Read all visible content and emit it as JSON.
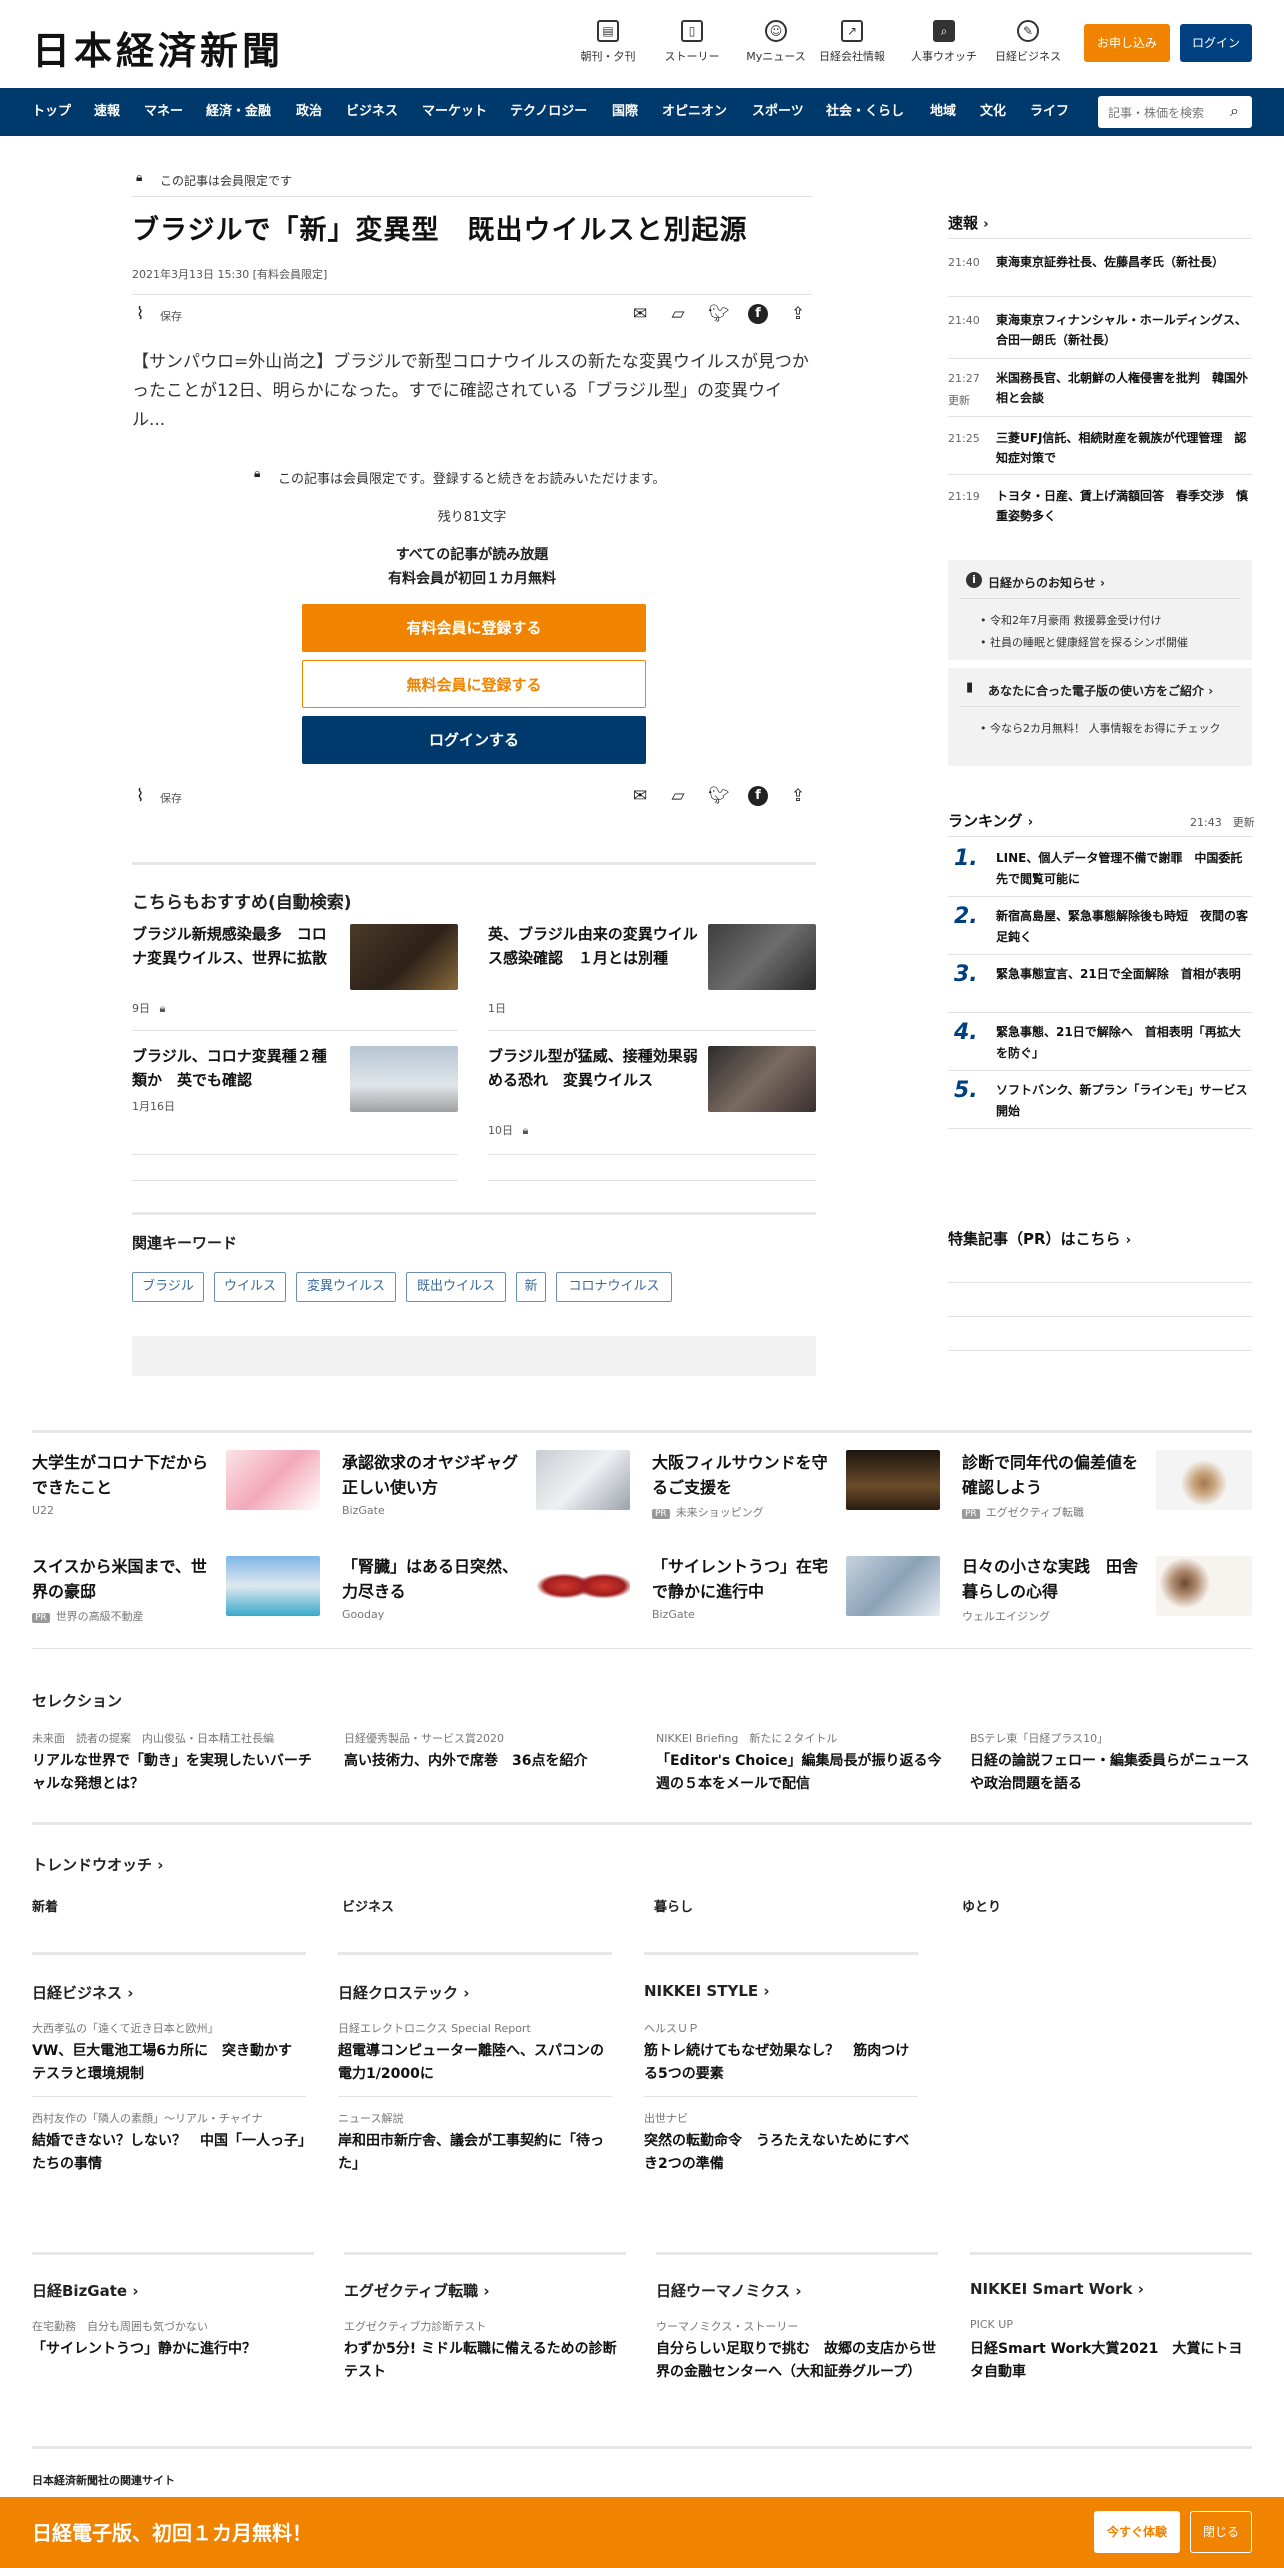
{
  "header": {
    "logo": "日本経済新聞",
    "icons": [
      {
        "label": "朝刊・夕刊",
        "icon": "newspaper-icon"
      },
      {
        "label": "ストーリー",
        "icon": "story-icon"
      },
      {
        "label": "Myニュース",
        "icon": "person-icon"
      },
      {
        "label": "日経会社情報",
        "icon": "chart-icon"
      },
      {
        "label": "人事ウオッチ",
        "icon": "search-icon"
      },
      {
        "label": "日経ビジネス",
        "icon": "compass-icon"
      }
    ],
    "subscribe": "お申し込み",
    "login": "ログイン"
  },
  "nav": {
    "items": [
      "トップ",
      "速報",
      "マネー",
      "経済・金融",
      "政治",
      "ビジネス",
      "マーケット",
      "テクノロジー",
      "国際",
      "オピニオン",
      "スポーツ",
      "社会・くらし",
      "地域",
      "文化",
      "ライフ"
    ],
    "search_placeholder": "記事・株価を検索"
  },
  "article": {
    "member_only": "この記事は会員限定です",
    "title": "ブラジルで「新」変異型　既出ウイルスと別起源",
    "date": "2021年3月13日 15:30 [有料会員限定]",
    "save": "保存",
    "lead": "【サンパウロ=外山尚之】ブラジルで新型コロナウイルスの新たな変異ウイルスが見つかったことが12日、明らかになった。すでに確認されている「ブラジル型」の変異ウイル...",
    "member_notice": "この記事は会員限定です。登録すると続きをお読みいただけます。",
    "remaining": "残り81文字",
    "promo1": "すべての記事が読み放題",
    "promo2": "有料会員が初回１カ月無料",
    "paid_btn": "有料会員に登録する",
    "free_btn": "無料会員に登録する",
    "login_btn": "ログインする",
    "save2": "保存"
  },
  "recommend": {
    "heading": "こちらもおすすめ(自動検索)",
    "items": [
      {
        "title": "ブラジル新規感染最多　コロナ変異ウイルス、世界に拡散",
        "meta": "9日"
      },
      {
        "title": "英、ブラジル由来の変異ウイルス感染確認　１月とは別種",
        "meta": "1日"
      },
      {
        "title": "ブラジル、コロナ変異種２種類か　英でも確認",
        "meta": "1月16日"
      },
      {
        "title": "ブラジル型が猛威、接種効果弱める恐れ　変異ウイルス",
        "meta": "10日"
      }
    ]
  },
  "keywords": {
    "heading": "関連キーワード",
    "items": [
      "ブラジル",
      "ウイルス",
      "変異ウイルス",
      "既出ウイルス",
      "新",
      "コロナウイルス"
    ]
  },
  "sidebar": {
    "breaking_heading": "速報",
    "breaking": [
      {
        "time": "21:40",
        "text": "東海東京証券社長、佐藤昌孝氏（新社長）"
      },
      {
        "time": "21:40",
        "text": "東海東京フィナンシャル・ホールディングス、合田一朗氏（新社長）"
      },
      {
        "time": "21:27",
        "badge": "更新",
        "text": "米国務長官、北朝鮮の人権侵害を批判　韓国外相と会談"
      },
      {
        "time": "21:25",
        "text": "三菱UFJ信託、相続財産を親族が代理管理　認知症対策で"
      },
      {
        "time": "21:19",
        "text": "トヨタ・日産、賃上げ満額回答　春季交渉　慎重姿勢多く"
      }
    ],
    "notice_heading": "日経からのお知らせ",
    "notices": [
      "令和2年7月豪雨 救援募金受け付け",
      "社員の睡眠と健康経営を探るシンポ開催"
    ],
    "guide_heading": "あなたに合った電子版の使い方をご紹介",
    "guide": "今なら2カ月無料！ 人事情報をお得にチェック",
    "ranking_heading": "ランキング",
    "ranking_time": "21:43",
    "ranking_update": "更新",
    "ranking": [
      {
        "num": "1.",
        "text": "LINE、個人データ管理不備で謝罪　中国委託先で閲覧可能に"
      },
      {
        "num": "2.",
        "text": "新宿高島屋、緊急事態解除後も時短　夜間の客足鈍く"
      },
      {
        "num": "3.",
        "text": "緊急事態宣言、21日で全面解除　首相が表明"
      },
      {
        "num": "4.",
        "text": "緊急事態、21日で解除へ　首相表明「再拡大を防ぐ」"
      },
      {
        "num": "5.",
        "text": "ソフトバンク、新プラン「ラインモ」サービス開始"
      }
    ],
    "feature_heading": "特集記事（PR）はこちら"
  },
  "promos": {
    "row1": [
      {
        "title": "大学生がコロナ下だからできたこと",
        "source": "U22",
        "pr": false
      },
      {
        "title": "承認欲求のオヤジギャグ正しい使い方",
        "source": "BizGate",
        "pr": false
      },
      {
        "title": "大阪フィルサウンドを守るご支援を",
        "source": "未来ショッピング",
        "pr": true
      },
      {
        "title": "診断で同年代の偏差値を確認しよう",
        "source": "エグゼクティブ転職",
        "pr": true
      }
    ],
    "row2": [
      {
        "title": "スイスから米国まで、世界の豪邸",
        "source": "世界の高級不動産",
        "pr": true
      },
      {
        "title": "「腎臓」はある日突然、力尽きる",
        "source": "Gooday",
        "pr": false
      },
      {
        "title": "「サイレントうつ」在宅で静かに進行中",
        "source": "BizGate",
        "pr": false
      },
      {
        "title": "日々の小さな実践　田舎暮らしの心得",
        "source": "ウェルエイジング",
        "pr": false
      }
    ],
    "pr_label": "PR"
  },
  "selection": {
    "heading": "セレクション",
    "items": [
      {
        "sub": "未来面　読者の提案　内山俊弘・日本精工社長編",
        "title": "リアルな世界で「動き」を実現したいバーチャルな発想とは？"
      },
      {
        "sub": "日経優秀製品・サービス賞2020",
        "title": "高い技術力、内外で席巻　36点を紹介"
      },
      {
        "sub": "NIKKEI Briefing　新たに２タイトル",
        "title": "「Editor's Choice」編集局長が振り返る今週の５本をメールで配信"
      },
      {
        "sub": "BSテレ東「日経プラス10」",
        "title": "日経の論説フェロー・編集委員らがニュースや政治問題を語る"
      }
    ]
  },
  "trend": {
    "heading": "トレンドウオッチ",
    "tabs": [
      "新着",
      "ビジネス",
      "暮らし",
      "ゆとり"
    ]
  },
  "media1": [
    {
      "heading": "日経ビジネス",
      "items": [
        {
          "sub": "大西孝弘の「遠くて近き日本と欧州」",
          "title": "VW、巨大電池工場6カ所に　突き動かすテスラと環境規制"
        },
        {
          "sub": "西村友作の「隣人の素顔」～リアル・チャイナ",
          "title": "結婚できない？しない？　中国「一人っ子」たちの事情"
        }
      ]
    },
    {
      "heading": "日経クロステック",
      "items": [
        {
          "sub": "日経エレクトロニクス Special Report",
          "title": "超電導コンピューター離陸へ、スパコンの電力1/2000に"
        },
        {
          "sub": "ニュース解説",
          "title": "岸和田市新庁舎、議会が工事契約に「待った」"
        }
      ]
    },
    {
      "heading": "NIKKEI STYLE",
      "items": [
        {
          "sub": "ヘルスＵＰ",
          "title": "筋トレ続けてもなぜ効果なし？　筋肉つける5つの要素"
        },
        {
          "sub": "出世ナビ",
          "title": "突然の転勤命令　うろたえないためにすべき2つの準備"
        }
      ]
    }
  ],
  "media2": [
    {
      "heading": "日経BizGate",
      "sub": "在宅勤務　自分も周囲も気づかない",
      "title": "「サイレントうつ」静かに進行中？"
    },
    {
      "heading": "エグゼクティブ転職",
      "sub": "エグゼクティブ力診断テスト",
      "title": "わずか5分! ミドル転職に備えるための診断テスト"
    },
    {
      "heading": "日経ウーマノミクス",
      "sub": "ウーマノミクス・ストーリー",
      "title": "自分らしい足取りで挑む　故郷の支店から世界の金融センターへ（大和証券グループ）"
    },
    {
      "heading": "NIKKEI Smart Work",
      "sub": "PICK UP",
      "title": "日経Smart Work大賞2021　大賞にトヨタ自動車"
    }
  ],
  "related_sites": "日本経済新聞社の関連サイト",
  "footer": {
    "promo": "日経電子版、初回１カ月無料！",
    "trial": "今すぐ体験",
    "close": "閉じる"
  },
  "colors": {
    "navy": "#00396b",
    "orange": "#f08300",
    "blue_btn": "#004080"
  }
}
